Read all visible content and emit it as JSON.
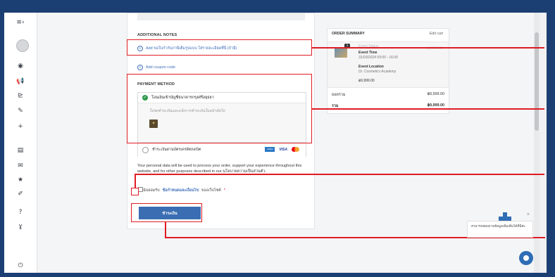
{
  "sidebar": {
    "icons": [
      {
        "name": "menu-icon",
        "glyph": "≡›"
      },
      {
        "name": "dashboard-icon",
        "glyph": "◉"
      },
      {
        "name": "marketing-icon",
        "glyph": "📢"
      },
      {
        "name": "chart-icon",
        "glyph": "⊵"
      },
      {
        "name": "tools-icon",
        "glyph": "✎"
      },
      {
        "name": "add-icon",
        "glyph": "+"
      },
      {
        "name": "products-icon",
        "glyph": "▤"
      },
      {
        "name": "mail-icon",
        "glyph": "✉"
      },
      {
        "name": "star-icon",
        "glyph": "★"
      },
      {
        "name": "edit-icon",
        "glyph": "✐"
      },
      {
        "name": "help-icon",
        "glyph": "?"
      },
      {
        "name": "plugin-icon",
        "glyph": "ɣ"
      },
      {
        "name": "power-icon",
        "glyph": "⏻"
      }
    ]
  },
  "checkout": {
    "additional_notes_title": "ADDITIONAL NOTES",
    "add_notes_link": "Add ขอใบกำกับภาษีเต็มรูปแบบ ใส่รายละเอียดที่นี่ (ถ้ามี)",
    "add_coupon_link": "Add coupon code",
    "payment_method_title": "PAYMENT METHOD",
    "bank_transfer_label": "โอนเงินเข้าบัญชีธนาคารกรุงศรีอยุธยา",
    "bank_instruction": "โปรดชำระเงินและแจ้งการชำระเงินในหน้าถัดไป",
    "bank_logo_glyph": "✦",
    "card_payment_label": "ชำระเงินผ่านบัตรเครดิต/เดบิต",
    "card_brands": [
      "AMEX",
      "VISA",
      "mastercard"
    ],
    "privacy_text": "Your personal data will be used to process your order, support your experience throughout this website, and for other purposes described in our นโยบายความเป็นส่วนตัว.",
    "terms_prefix": "ฉันยอมรับ",
    "terms_link": "ข้อกำหนดและเงื่อนไข",
    "terms_suffix": "ของเว็บไซต์",
    "terms_required": "*",
    "pay_button": "ชำระเงิน"
  },
  "order_summary": {
    "title": "ORDER SUMMARY",
    "edit_cart": "Edit cart",
    "qty": "1",
    "item_top_label": "Event Status",
    "item_price_top": "฿9,999.00",
    "event_time_label": "Event Time",
    "event_time_value": "31/03/2024 09:00 - 16:00",
    "event_location_label": "Event Location",
    "event_location_value": "Dr. Cosmetics Academy",
    "item_price": "฿9,999.00",
    "subtotal_label": "ยอดรวม",
    "subtotal_value": "฿9,999.00",
    "total_label": "รวม",
    "total_value": "฿9,999.00"
  },
  "help_widget": {
    "text": "สามารถสอบถามข้อมูลเพิ่มเติมได้ที่นี่ค่ะ",
    "close_glyph": "×"
  },
  "colors": {
    "accent": "#3b6db3",
    "highlight": "#e01b24",
    "success": "#2e9a4b"
  }
}
